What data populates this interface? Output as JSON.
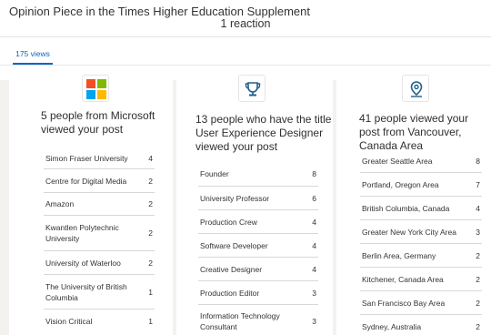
{
  "header": {
    "title": "Opinion Piece in the Times Higher Education Supplement",
    "reactions": "1 reaction",
    "tab_views": "175 views"
  },
  "columns": [
    {
      "icon": "microsoft-logo",
      "heading": "5 people from Microsoft viewed your post",
      "rows": [
        {
          "label": "Simon Fraser University",
          "count": "4"
        },
        {
          "label": "Centre for Digital Media",
          "count": "2"
        },
        {
          "label": "Amazon",
          "count": "2"
        },
        {
          "label": "Kwantlen Polytechnic University",
          "count": "2"
        },
        {
          "label": "University of Waterloo",
          "count": "2"
        },
        {
          "label": "The University of British Columbia",
          "count": "1"
        },
        {
          "label": "Vision Critical",
          "count": "1"
        }
      ]
    },
    {
      "icon": "trophy-icon",
      "heading": "13 people who have the title User Experience Designer viewed your post",
      "rows": [
        {
          "label": "Founder",
          "count": "8"
        },
        {
          "label": "University Professor",
          "count": "6"
        },
        {
          "label": "Production Crew",
          "count": "4"
        },
        {
          "label": "Software Developer",
          "count": "4"
        },
        {
          "label": "Creative Designer",
          "count": "4"
        },
        {
          "label": "Production Editor",
          "count": "3"
        },
        {
          "label": "Information Technology Consultant",
          "count": "3"
        }
      ]
    },
    {
      "icon": "location-pin-icon",
      "heading": "41 people viewed your post from Vancouver, Canada Area",
      "rows": [
        {
          "label": "Greater Seattle Area",
          "count": "8"
        },
        {
          "label": "Portland, Oregon Area",
          "count": "7"
        },
        {
          "label": "British Columbia, Canada",
          "count": "4"
        },
        {
          "label": "Greater New York City Area",
          "count": "3"
        },
        {
          "label": "Berlin Area, Germany",
          "count": "2"
        },
        {
          "label": "Kitchener, Canada Area",
          "count": "2"
        },
        {
          "label": "San Francisco Bay Area",
          "count": "2"
        },
        {
          "label": "Sydney, Australia",
          "count": "2"
        }
      ]
    }
  ],
  "colors": {
    "accent": "#0a66c2",
    "ms_red": "#f25022",
    "ms_green": "#7fba00",
    "ms_blue": "#00a4ef",
    "ms_yellow": "#ffb900",
    "icon_blue": "#1f5f8b"
  }
}
